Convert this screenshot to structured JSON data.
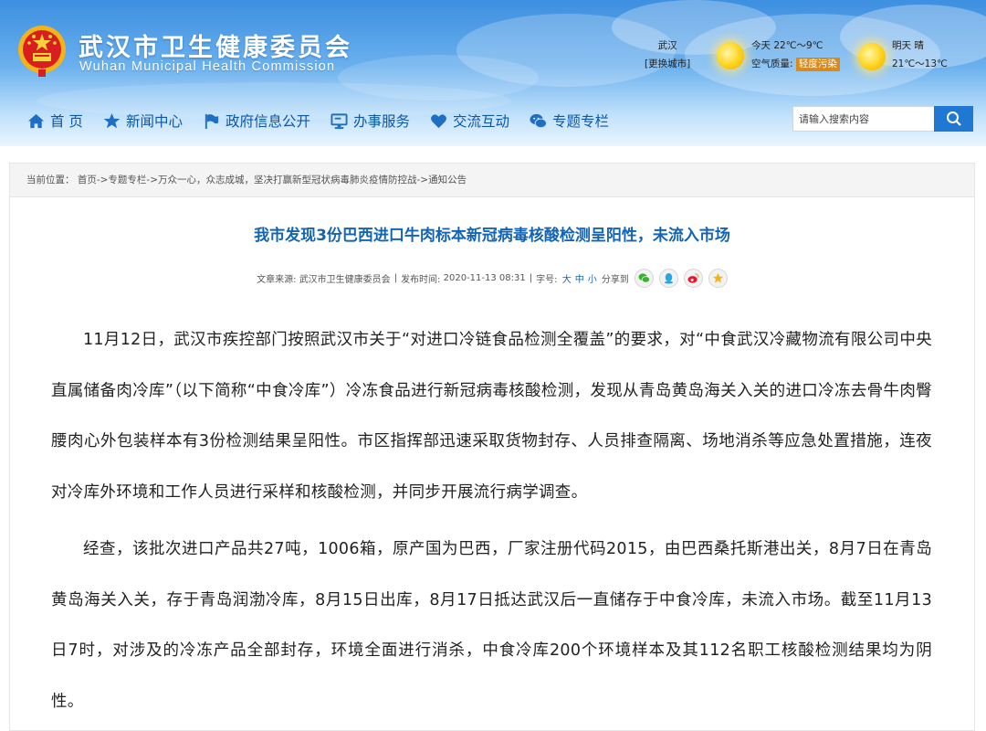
{
  "header": {
    "title": "武汉市卫生健康委员会",
    "subtitle": "Wuhan Municipal Health Commission"
  },
  "weather": {
    "city": "武汉",
    "change_city": "[更换城市]",
    "today_label": "今天",
    "today_temp": "22℃～9℃",
    "air_quality_label": "空气质量:",
    "air_quality_value": "轻度污染",
    "tomorrow_label": "明天",
    "tomorrow_condition": "晴",
    "tomorrow_temp": "21℃～13℃"
  },
  "nav": {
    "items": [
      {
        "label": "首 页",
        "icon": "home-icon"
      },
      {
        "label": "新闻中心",
        "icon": "star-icon"
      },
      {
        "label": "政府信息公开",
        "icon": "flag-icon"
      },
      {
        "label": "办事服务",
        "icon": "monitor-icon"
      },
      {
        "label": "交流互动",
        "icon": "heart-icon"
      },
      {
        "label": "专题专栏",
        "icon": "chat-icon"
      }
    ]
  },
  "search": {
    "placeholder": "请输入搜索内容"
  },
  "breadcrumb": {
    "label": "当前位置：",
    "trail": "首页->专题专栏->万众一心，众志成城，坚决打赢新型冠状病毒肺炎疫情防控战->通知公告"
  },
  "article": {
    "title": "我市发现3份巴西进口牛肉标本新冠病毒核酸检测呈阳性，未流入市场",
    "meta": {
      "source_label": "文章来源:",
      "source": "武汉市卫生健康委员会",
      "sep": "|",
      "published_label": "发布时间:",
      "published": "2020-11-13 08:31",
      "font_label": "字号:",
      "size_large": "大",
      "size_medium": "中",
      "size_small": "小",
      "share_label": "分享到"
    },
    "share_icons": [
      "wechat-icon",
      "qq-icon",
      "weibo-icon",
      "favorite-icon"
    ],
    "paragraphs": [
      "11月12日，武汉市疾控部门按照武汉市关于“对进口冷链食品检测全覆盖”的要求，对“中食武汉冷藏物流有限公司中央直属储备肉冷库”（以下简称“中食冷库”）冷冻食品进行新冠病毒核酸检测，发现从青岛黄岛海关入关的进口冷冻去骨牛肉臀腰肉心外包装样本有3份检测结果呈阳性。市区指挥部迅速采取货物封存、人员排查隔离、场地消杀等应急处置措施，连夜对冷库外环境和工作人员进行采样和核酸检测，并同步开展流行病学调查。",
      "经查，该批次进口产品共27吨，1006箱，原产国为巴西，厂家注册代码2015，由巴西桑托斯港出关，8月7日在青岛黄岛海关入关，存于青岛润渤冷库，8月15日出库，8月17日抵达武汉后一直储存于中食冷库，未流入市场。截至11月13日7时，对涉及的冷冻产品全部封存，环境全面进行消杀，中食冷库200个环境样本及其112名职工核酸检测结果均为阴性。"
    ]
  },
  "colors": {
    "header_top": "#3d8fe0",
    "nav_text": "#0d57a8",
    "title_blue": "#1464b4",
    "search_button": "#1f78d1",
    "aq_badge": "#d98a1c"
  }
}
